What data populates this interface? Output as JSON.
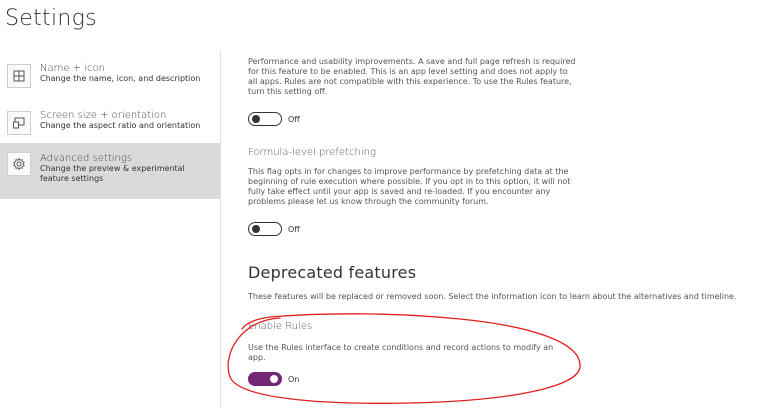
{
  "page": {
    "title": "Settings"
  },
  "sidebar": {
    "items": [
      {
        "title": "Name + icon",
        "description": "Change the name, icon, and description",
        "icon": "grid-icon",
        "selected": false
      },
      {
        "title": "Screen size + orientation",
        "description": "Change the aspect ratio and orientation",
        "icon": "screen-orientation-icon",
        "selected": false
      },
      {
        "title": "Advanced settings",
        "description": "Change the preview & experimental feature settings",
        "icon": "gear-icon",
        "selected": true
      }
    ]
  },
  "main": {
    "feature_top": {
      "description": "Performance and usability improvements. A save and full page refresh is required for this feature to be enabled. This is an app level setting and does not apply to all apps. Rules are not compatible with this experience. To use the Rules feature, turn this setting off.",
      "toggle_state": "Off"
    },
    "formula_prefetch": {
      "title": "Formula-level prefetching",
      "description": "This flag opts in for changes to improve performance by prefetching data at the beginning of rule execution where possible. If you opt in to this option, it will not fully take effect until your app is saved and re-loaded. If you encounter any problems please let us know through the community forum.",
      "toggle_state": "Off"
    },
    "deprecated": {
      "heading": "Deprecated features",
      "description": "These features will be replaced or removed soon. Select the information icon to learn about the alternatives and timeline."
    },
    "enable_rules": {
      "title": "Enable Rules",
      "description": "Use the Rules interface to create conditions and record actions to modify an app.",
      "toggle_state": "On"
    }
  },
  "colors": {
    "accent": "#742774",
    "selected_bg": "#dadada",
    "annotation": "#e0201e"
  }
}
